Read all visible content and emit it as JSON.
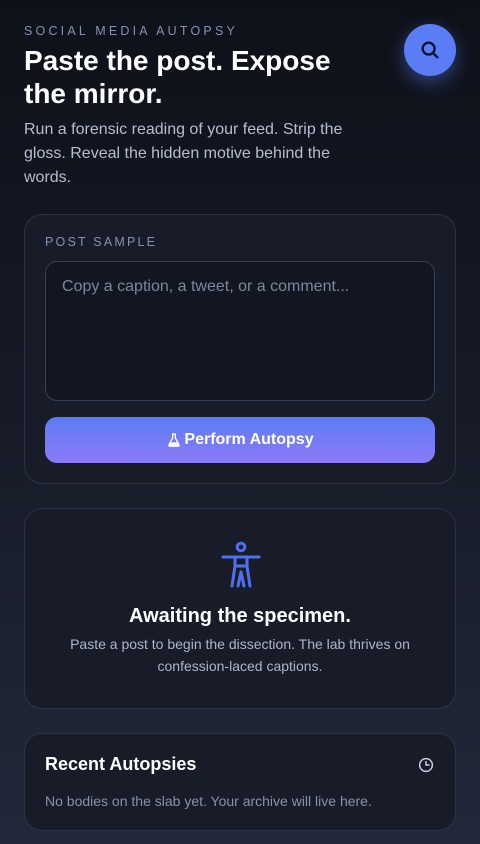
{
  "header": {
    "eyebrow": "SOCIAL MEDIA AUTOPSY",
    "title": "Paste the post. Expose the mirror.",
    "subtitle": "Run a forensic reading of your feed. Strip the gloss. Reveal the hidden motive behind the words.",
    "search_icon": "search-icon"
  },
  "input_card": {
    "label": "POST SAMPLE",
    "placeholder": "Copy a caption, a tweet, or a comment...",
    "value": "",
    "button_label": "Perform Autopsy",
    "button_icon": "flask-icon"
  },
  "empty_state": {
    "icon": "person-figure-icon",
    "title": "Awaiting the specimen.",
    "description": "Paste a post to begin the dissection. The lab thrives on confession-laced captions."
  },
  "recent": {
    "title": "Recent Autopsies",
    "icon": "history-clock-icon",
    "empty_text": "No bodies on the slab yet. Your archive will live here."
  },
  "colors": {
    "accent": "#5a7cf5",
    "button_gradient_start": "#5b7cf3",
    "button_gradient_end": "#8c7af7",
    "card_background": "#181c29"
  }
}
